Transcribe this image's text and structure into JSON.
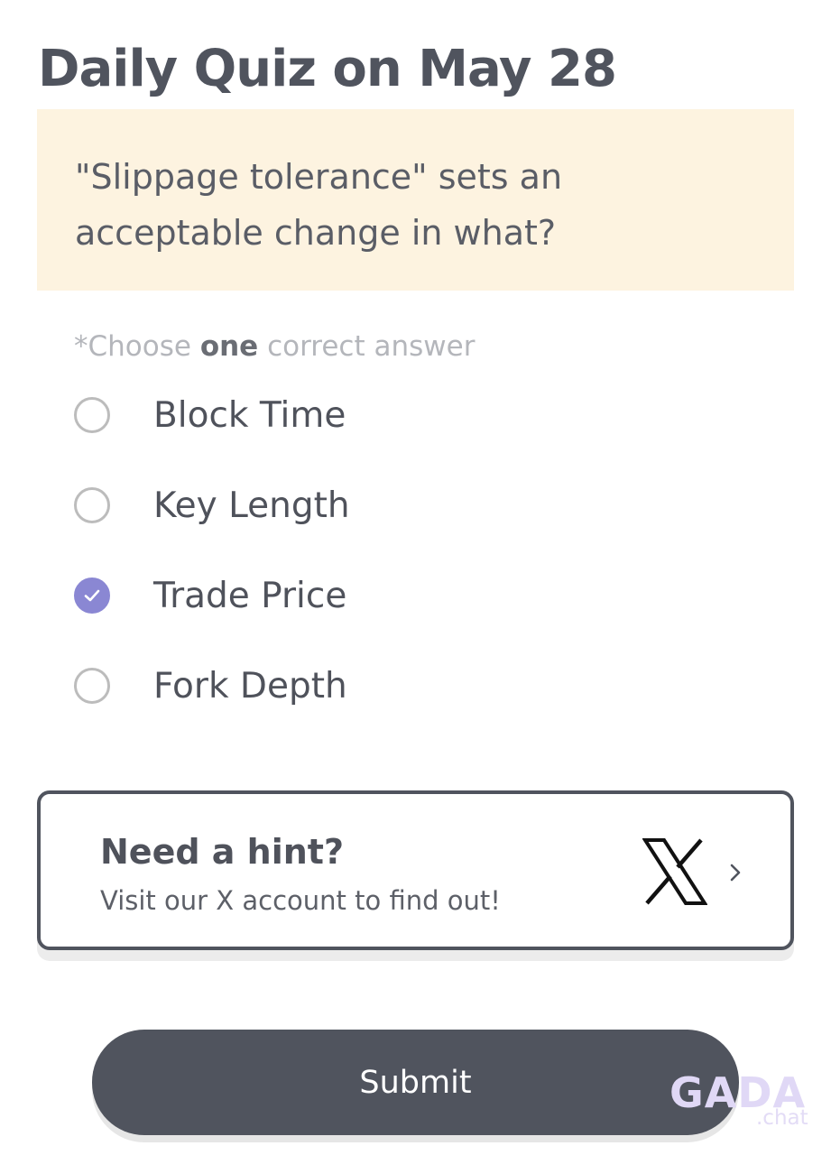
{
  "quiz": {
    "title": "Daily Quiz on May 28",
    "question_line1": "\"Slippage tolerance\" sets an",
    "question_line2": "acceptable change in what?",
    "instruction_prefix": "*Choose ",
    "instruction_bold": "one",
    "instruction_suffix": " correct answer",
    "options": [
      {
        "label": "Block Time",
        "selected": false
      },
      {
        "label": "Key Length",
        "selected": false
      },
      {
        "label": "Trade Price",
        "selected": true
      },
      {
        "label": "Fork Depth",
        "selected": false
      }
    ]
  },
  "hint": {
    "title": "Need a hint?",
    "subtitle": "Visit our X account to find out!",
    "icon": "x-logo-icon",
    "arrow_icon": "chevron-right-icon"
  },
  "submit": {
    "label": "Submit"
  },
  "watermark": {
    "brand": "GADA",
    "domain": ".chat"
  },
  "colors": {
    "text_dark": "#50545e",
    "question_bg": "#fdf3e0",
    "selected_radio": "#8a87d3",
    "radio_border": "#bcbcbc",
    "submit_bg": "#50545e"
  }
}
